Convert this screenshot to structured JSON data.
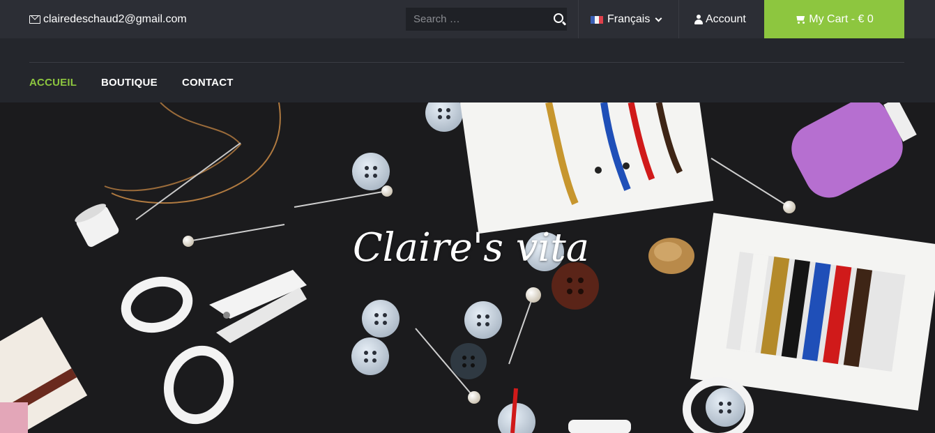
{
  "topbar": {
    "email": "clairedeschaud2@gmail.com",
    "search_placeholder": "Search …",
    "language": "Français",
    "account": "Account",
    "cart": "My Cart - € 0"
  },
  "nav": {
    "items": [
      "ACCUEIL",
      "BOUTIQUE",
      "CONTACT"
    ]
  },
  "hero": {
    "title": "Claire's vita"
  },
  "colors": {
    "accent": "#8dc63f",
    "topbar_bg": "#2c2e35",
    "nav_bg": "#24262c",
    "hero_bg": "#1b1b1d"
  },
  "icons": [
    "envelope-icon",
    "search-icon",
    "french-flag-icon",
    "chevron-down-icon",
    "user-icon",
    "cart-icon"
  ]
}
